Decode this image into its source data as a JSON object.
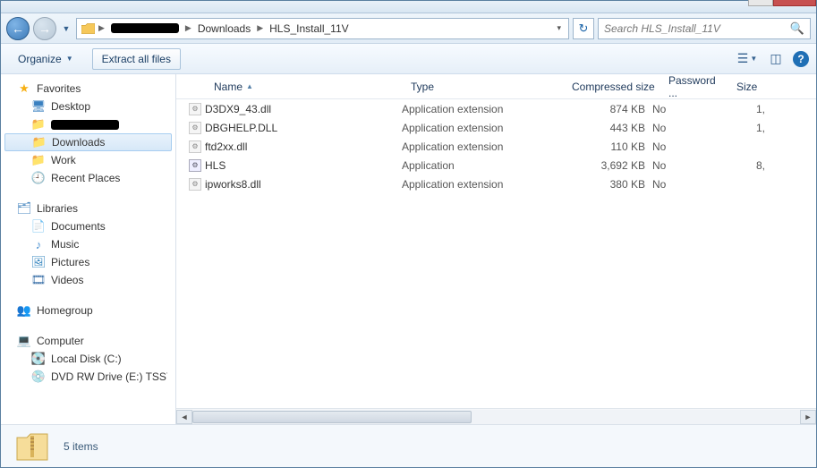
{
  "breadcrumbs": {
    "seg1": "Downloads",
    "seg2": "HLS_Install_11V"
  },
  "search": {
    "placeholder": "Search HLS_Install_11V"
  },
  "toolbar": {
    "organize": "Organize",
    "extract": "Extract all files"
  },
  "columns": {
    "name": "Name",
    "type": "Type",
    "csize": "Compressed size",
    "pw": "Password ...",
    "size": "Size"
  },
  "nav": {
    "favorites": "Favorites",
    "desktop": "Desktop",
    "downloads": "Downloads",
    "work": "Work",
    "recent": "Recent Places",
    "libraries": "Libraries",
    "documents": "Documents",
    "music": "Music",
    "pictures": "Pictures",
    "videos": "Videos",
    "homegroup": "Homegroup",
    "computer": "Computer",
    "localdisk": "Local Disk (C:)",
    "dvd": "DVD RW Drive (E:) TSSY"
  },
  "files": [
    {
      "name": "D3DX9_43.dll",
      "type": "Application extension",
      "csize": "874 KB",
      "pw": "No",
      "size": "1,",
      "kind": "dll"
    },
    {
      "name": "DBGHELP.DLL",
      "type": "Application extension",
      "csize": "443 KB",
      "pw": "No",
      "size": "1,",
      "kind": "dll"
    },
    {
      "name": "ftd2xx.dll",
      "type": "Application extension",
      "csize": "110 KB",
      "pw": "No",
      "size": "",
      "kind": "dll"
    },
    {
      "name": "HLS",
      "type": "Application",
      "csize": "3,692 KB",
      "pw": "No",
      "size": "8,",
      "kind": "exe"
    },
    {
      "name": "ipworks8.dll",
      "type": "Application extension",
      "csize": "380 KB",
      "pw": "No",
      "size": "",
      "kind": "dll"
    }
  ],
  "status": {
    "count": "5 items"
  }
}
